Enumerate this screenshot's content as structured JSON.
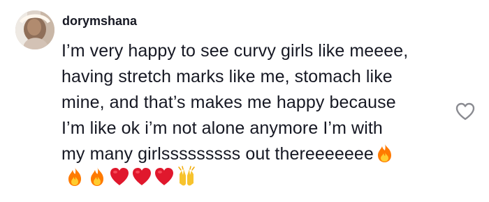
{
  "comment": {
    "username": "dorymshana",
    "text_lines": [
      "I’m very happy to see curvy girls like meeee,",
      "having stretch marks like me, stomach like",
      "mine, and that’s makes me happy because",
      "I’m like ok i’m not alone anymore I’m with",
      "my many girlsssssssss out thereeeeeee"
    ],
    "emojis": [
      "fire",
      "fire",
      "fire",
      "red-heart",
      "red-heart",
      "red-heart",
      "raising-hands"
    ],
    "colors": {
      "text": "#161823",
      "fire_outer": "#ff7a00",
      "fire_inner": "#ffcc2f",
      "heart": "#e0182d",
      "hands": "#f7c32e",
      "like_outline": "#8a8b91"
    }
  }
}
